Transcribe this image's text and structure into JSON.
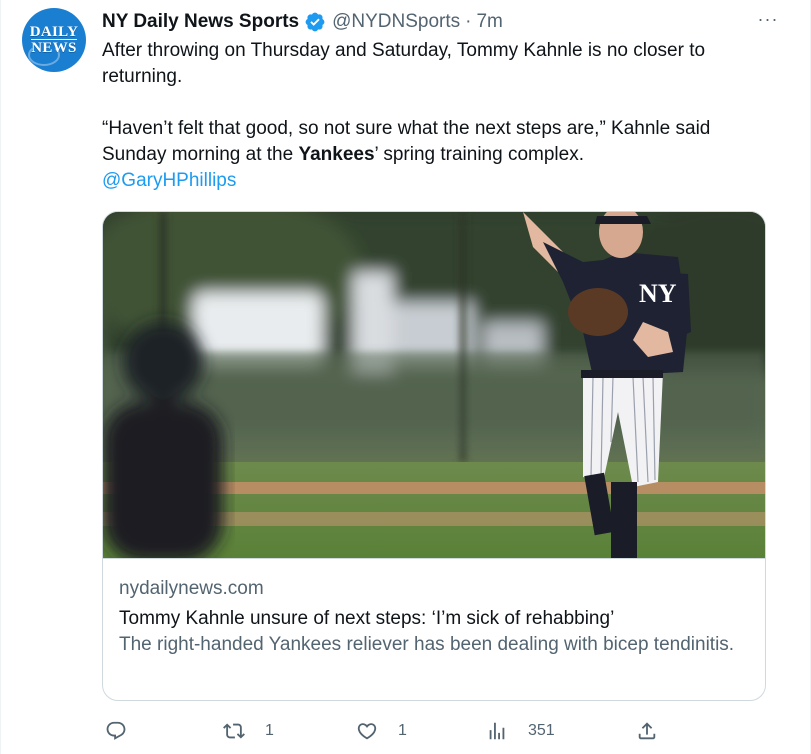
{
  "account": {
    "avatar_text_line1": "DAILY",
    "avatar_text_line2": "NEWS",
    "display_name": "NY Daily News Sports",
    "handle": "@NYDNSports",
    "separator": "·",
    "timestamp": "7m",
    "verified_color": "#1d9bf0"
  },
  "more_icon": "more-horizontal-icon",
  "more_label": "···",
  "tweet": {
    "paragraph1": "After throwing on Thursday and Saturday, Tommy Kahnle is no closer to returning.",
    "paragraph2_before": "“Haven’t felt that good, so not sure what the next steps are,” Kahnle said Sunday morning at the ",
    "paragraph2_bold": "Yankees",
    "paragraph2_after": "’ spring training complex.",
    "mention": "@GaryHPhillips"
  },
  "card": {
    "image_description_icon": "photo-baseball-pitcher",
    "domain": "nydailynews.com",
    "title": "Tommy Kahnle unsure of next steps: ‘I’m sick of rehabbing’",
    "description": "The right-handed Yankees reliever has been dealing with bicep tendinitis."
  },
  "actions": {
    "reply": {
      "icon": "reply-icon",
      "count": ""
    },
    "retweet": {
      "icon": "retweet-icon",
      "count": "1"
    },
    "like": {
      "icon": "heart-icon",
      "count": "1"
    },
    "views": {
      "icon": "views-icon",
      "count": "351"
    },
    "share": {
      "icon": "share-icon",
      "count": ""
    }
  },
  "colors": {
    "text_primary": "#0f1419",
    "text_secondary": "#536471",
    "link": "#1d9bf0",
    "border": "#cfd9de",
    "avatar_bg": "#1b7fd1"
  }
}
